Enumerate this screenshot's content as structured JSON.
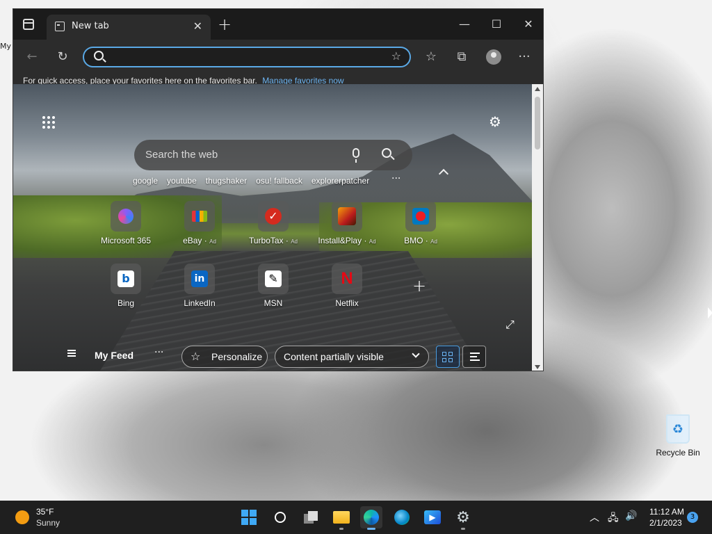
{
  "desktop": {
    "partial_label": "My",
    "recycle_bin_label": "Recycle Bin"
  },
  "browser": {
    "tab_title": "New tab",
    "address_value": "",
    "favbar_text": "For quick access, place your favorites here on the favorites bar.",
    "favbar_link": "Manage favorites now"
  },
  "newtab": {
    "search_placeholder": "Search the web",
    "chips": [
      "google",
      "youtube",
      "thugshaker",
      "osu! fallback",
      "explorerpatcher"
    ],
    "tiles_row1": [
      {
        "label": "Microsoft 365",
        "ad": ""
      },
      {
        "label": "eBay",
        "ad": "Ad"
      },
      {
        "label": "TurboTax",
        "ad": "Ad"
      },
      {
        "label": "Install&Play",
        "ad": "Ad"
      },
      {
        "label": "BMO",
        "ad": "Ad"
      }
    ],
    "tiles_row2": [
      {
        "label": "Bing"
      },
      {
        "label": "LinkedIn"
      },
      {
        "label": "MSN"
      },
      {
        "label": "Netflix"
      }
    ],
    "feed_label": "My Feed",
    "personalize_label": "Personalize",
    "visibility_option": "Content partially visible"
  },
  "taskbar": {
    "weather_temp": "35°F",
    "weather_condition": "Sunny",
    "time": "11:12 AM",
    "date": "2/1/2023",
    "notification_count": "3"
  },
  "colors": {
    "accent": "#4a9de0",
    "taskbar_bg": "#1f1f1f",
    "browser_bg": "#2c2c2c"
  }
}
